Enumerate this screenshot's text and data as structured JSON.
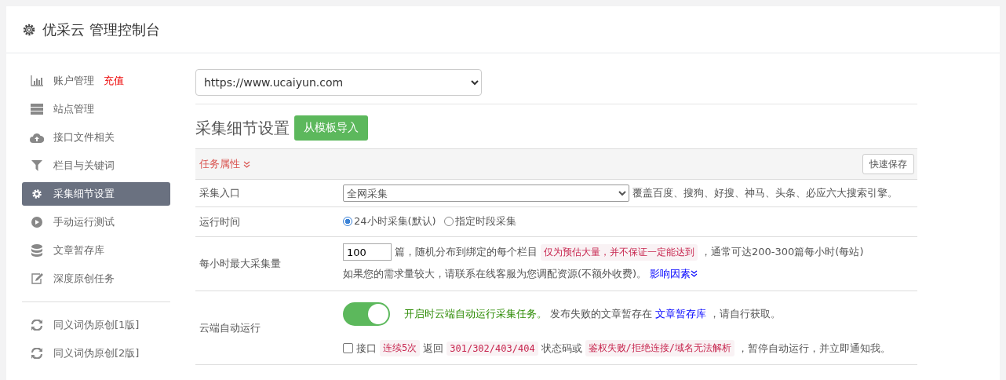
{
  "header": {
    "title": "优采云 管理控制台"
  },
  "sidebar": {
    "groups": [
      [
        {
          "label": "账户管理",
          "badge": "充值",
          "kind": "chart",
          "selected": false
        },
        {
          "label": "站点管理",
          "kind": "server",
          "selected": false
        },
        {
          "label": "接口文件相关",
          "kind": "cloud",
          "selected": false
        },
        {
          "label": "栏目与关键词",
          "kind": "filter",
          "selected": false
        },
        {
          "label": "采集细节设置",
          "kind": "gear",
          "selected": true
        },
        {
          "label": "手动运行测试",
          "kind": "play",
          "selected": false
        },
        {
          "label": "文章暂存库",
          "kind": "database",
          "selected": false
        },
        {
          "label": "深度原创任务",
          "kind": "edit",
          "selected": false
        }
      ],
      [
        {
          "label": "同义词伪原创[1版]",
          "kind": "refresh",
          "selected": false
        },
        {
          "label": "同义词伪原创[2版]",
          "kind": "refresh",
          "selected": false
        }
      ]
    ]
  },
  "site_select": {
    "value": "https://www.ucaiyun.com"
  },
  "section": {
    "title": "采集细节设置",
    "import_button": "从模板导入"
  },
  "table": {
    "header": {
      "label": "任务属性",
      "save_button": "快速保存"
    },
    "rows": [
      {
        "kind": "entry",
        "label": "采集入口",
        "select": "全网采集",
        "text": "覆盖百度、搜狗、好搜、神马、头条、必应六大搜索引擎。"
      },
      {
        "kind": "schedule",
        "label": "运行时间",
        "options": [
          {
            "label": "24小时采集(默认)",
            "selected": true
          },
          {
            "label": "指定时段采集",
            "selected": false
          }
        ]
      },
      {
        "kind": "rate",
        "label": "每小时最大采集量",
        "value": "100",
        "segments": [
          {
            "kind": "text",
            "text": "篇，随机分布到绑定的每个栏目"
          },
          {
            "kind": "code",
            "text": "仅为预估大量，并不保证一定能达到"
          },
          {
            "kind": "text",
            "text": "，通常可达200-300篇每小时(每站)"
          }
        ],
        "note": "如果您的需求量较大，请联系在线客服为您调配资源(不额外收费)。",
        "link": "影响因素"
      },
      {
        "kind": "cloud",
        "label": "云端自动运行",
        "on": true,
        "lead": "开启时云端自动运行采集任务。",
        "segments": [
          {
            "kind": "text",
            "text": "发布失败的文章暂存在"
          },
          {
            "kind": "link",
            "text": "文章暂存库"
          },
          {
            "kind": "text",
            "text": "，请自行获取。"
          }
        ],
        "checkbox": {
          "checked": false,
          "segments": [
            {
              "kind": "text",
              "text": "接口"
            },
            {
              "kind": "code",
              "text": "连续5次"
            },
            {
              "kind": "text",
              "text": "返回"
            },
            {
              "kind": "code",
              "text": "301/302/403/404"
            },
            {
              "kind": "text",
              "text": "状态码或"
            },
            {
              "kind": "code",
              "text": "鉴权失败/拒绝连接/域名无法解析"
            },
            {
              "kind": "text",
              "text": "，暂停自动运行，并立即通知我。"
            }
          ]
        }
      }
    ]
  }
}
